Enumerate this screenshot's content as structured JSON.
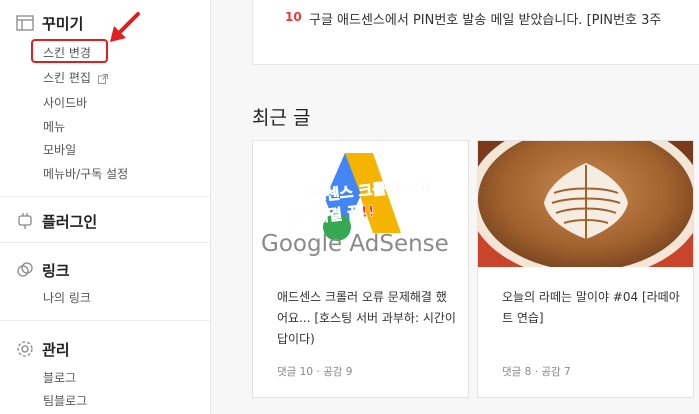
{
  "sidebar": {
    "groups": [
      {
        "title": "꾸미기",
        "icon": "layout-icon",
        "items": [
          "스킨 변경",
          "스킨 편집",
          "사이드바",
          "메뉴",
          "모바일",
          "메뉴바/구독 설정"
        ]
      },
      {
        "title": "플러그인",
        "icon": "plug-icon",
        "items": []
      },
      {
        "title": "링크",
        "icon": "link-icon",
        "items": [
          "나의 링크"
        ]
      },
      {
        "title": "관리",
        "icon": "gear-icon",
        "items": [
          "블로그",
          "팀블로그"
        ]
      }
    ]
  },
  "notice": {
    "number": "10",
    "text": "구글 애드센스에서 PIN번호 발송 메일 받았습니다. [PIN번호 3주"
  },
  "recent": {
    "title": "최근 글",
    "posts": [
      {
        "title": "애드센스 크롤러 오류 문제해결 했어요... [호스팅 서버 과부하: 시간이 답이다)",
        "comments_label": "댓글 10",
        "likes_label": "공감 9",
        "thumb_overlay": "애드센스 크롤러 오류 문제해결 끝!!",
        "thumb_brand": "Google AdSense"
      },
      {
        "title": "오늘의 라떼는 말이야 #04 [라떼아트 연습]",
        "comments_label": "댓글 8",
        "likes_label": "공감 7"
      }
    ]
  },
  "colors": {
    "highlight": "#e02020",
    "accent_red": "#e03c3c"
  }
}
